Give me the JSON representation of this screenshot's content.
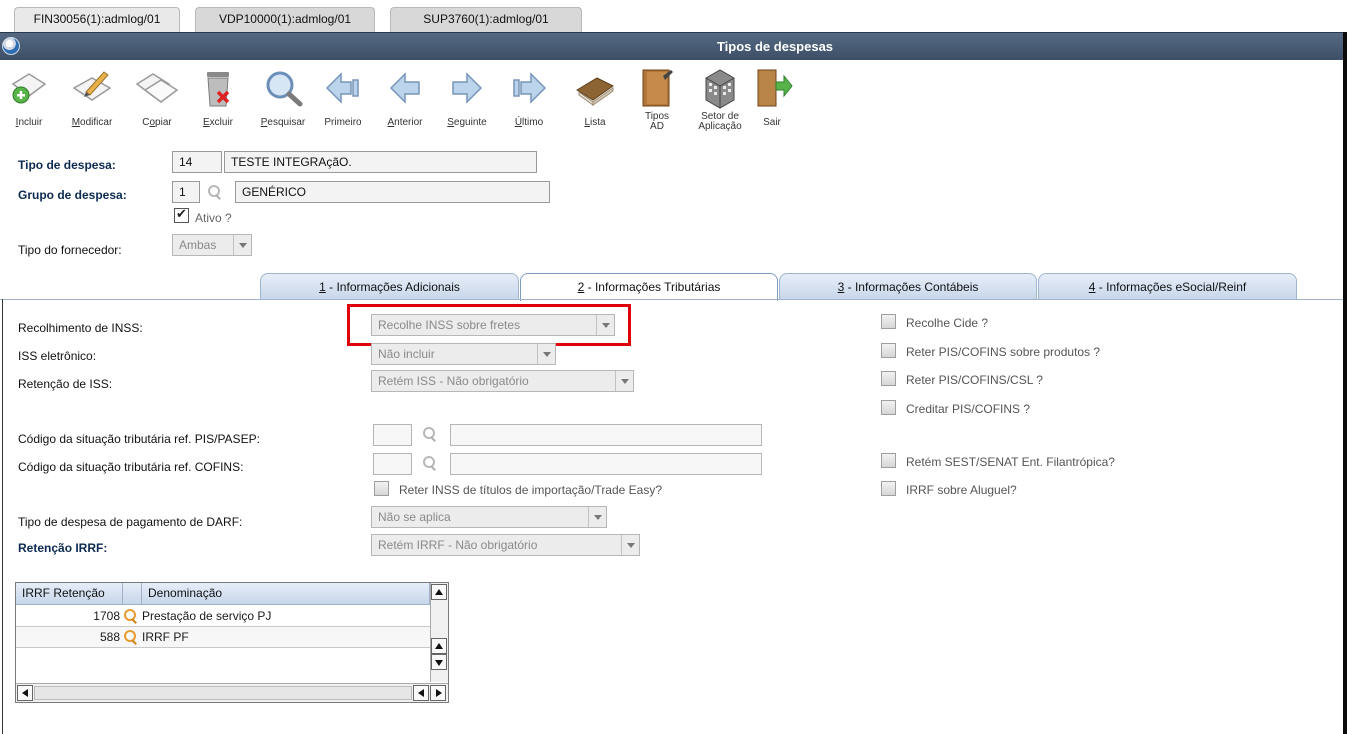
{
  "window_tabs": [
    {
      "label": "FIN30056(1):admlog/01"
    },
    {
      "label": "VDP10000(1):admlog/01"
    },
    {
      "label": "SUP3760(1):admlog/01"
    }
  ],
  "window": {
    "title": "Tipos de despesas"
  },
  "toolbar": {
    "incluir": {
      "pre": "",
      "u": "I",
      "post": "ncluir"
    },
    "modificar": {
      "pre": "",
      "u": "M",
      "post": "odificar"
    },
    "copiar": {
      "pre": "C",
      "u": "o",
      "post": "piar"
    },
    "excluir": {
      "pre": "",
      "u": "E",
      "post": "xcluir"
    },
    "pesquisar": {
      "pre": "",
      "u": "P",
      "post": "esquisar"
    },
    "primeiro": {
      "pre": "Primeiro",
      "u": "",
      "post": ""
    },
    "anterior": {
      "pre": "",
      "u": "A",
      "post": "nterior"
    },
    "seguinte": {
      "pre": "",
      "u": "S",
      "post": "eguinte"
    },
    "ultimo": {
      "pre": "",
      "u": "Ú",
      "post": "ltimo"
    },
    "lista": {
      "pre": "",
      "u": "L",
      "post": "ista"
    },
    "tipos_ad": {
      "line1": "Tipos",
      "line2": "AD"
    },
    "setor": {
      "line1": "Setor de",
      "line2": "Aplicação"
    },
    "sair": {
      "pre": "Sair",
      "u": "",
      "post": ""
    }
  },
  "header": {
    "tipo_despesa_label": "Tipo de despesa:",
    "tipo_despesa_code": "14",
    "tipo_despesa_desc": "TESTE INTEGRAçãO.",
    "grupo_label": "Grupo de despesa:",
    "grupo_code": "1",
    "grupo_desc": "GENÉRICO",
    "ativo_label": "Ativo ?",
    "ativo_checked": true,
    "fornecedor_label": "Tipo do fornecedor:",
    "fornecedor_value": "Ambas"
  },
  "tabs": [
    {
      "num": "1",
      "label": " - Informações Adicionais"
    },
    {
      "num": "2",
      "label": " - Informações Tributárias",
      "active": true
    },
    {
      "num": "3",
      "label": " - Informações Contábeis"
    },
    {
      "num": "4",
      "label": " - Informações eSocial/Reinf"
    }
  ],
  "tributarias": {
    "inss_label": "Recolhimento de INSS:",
    "inss_value": "Recolhe INSS sobre fretes",
    "iss_eletronico_label": "ISS eletrônico:",
    "iss_eletronico_value": "Não incluir",
    "retencao_iss_label": "Retenção de ISS:",
    "retencao_iss_value": "Retém ISS - Não obrigatório",
    "cst_pis_label": "Código da situação tributária ref. PIS/PASEP:",
    "cst_cofins_label": "Código da situação tributária ref. COFINS:",
    "reter_inss_import_label": "Reter INSS de títulos de importação/Trade Easy?",
    "darf_label": "Tipo de despesa de pagamento de DARF:",
    "darf_value": "Não se aplica",
    "irrf_label": "Retenção IRRF:",
    "irrf_value": "Retém IRRF - Não obrigatório",
    "right_checks": [
      "Recolhe Cide ?",
      "Reter PIS/COFINS sobre produtos ?",
      "Reter PIS/COFINS/CSL ?",
      "Creditar PIS/COFINS ?",
      "Retém SEST/SENAT Ent. Filantrópica?",
      "IRRF sobre Aluguel?"
    ]
  },
  "irrf_grid": {
    "col1": "IRRF Retenção",
    "col2": "Denominação",
    "rows": [
      {
        "code": "1708",
        "name": "Prestação de serviço PJ"
      },
      {
        "code": "588",
        "name": "IRRF PF"
      }
    ]
  },
  "colors": {
    "titlebar": "#46586f",
    "highlight": "#e0000a",
    "tab": "#c6d6ea"
  }
}
